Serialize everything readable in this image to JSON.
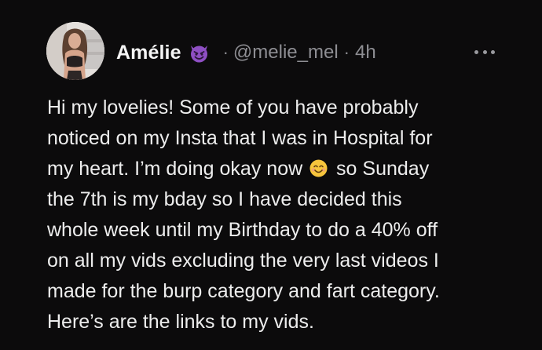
{
  "post": {
    "author_name": "Amélie",
    "badge_icon": "smiling-devil-emoji",
    "separator": "·",
    "handle": "@melie_mel",
    "time": "4h",
    "menu_icon": "more-horizontal-icon",
    "lines": {
      "l1": "Hi my lovelies! Some of you have probably",
      "l2": "noticed on my Insta that I was in Hospital for",
      "l3a": "my heart. I’m doing okay now",
      "l3_emoji": "smiling-face-emoji",
      "l3b": " so Sunday",
      "l4": "the 7th is my bday so I have decided this",
      "l5": "whole week until my Birthday to do a 40% off",
      "l6": "on all my vids excluding the very last videos I",
      "l7": "made for the burp category and fart category.",
      "l8": "Here’s are the links to my vids."
    }
  },
  "colors": {
    "background": "#0c0b0c",
    "text": "#ededed",
    "muted": "#8e8e93",
    "badge_purple": "#8e4fc3"
  }
}
